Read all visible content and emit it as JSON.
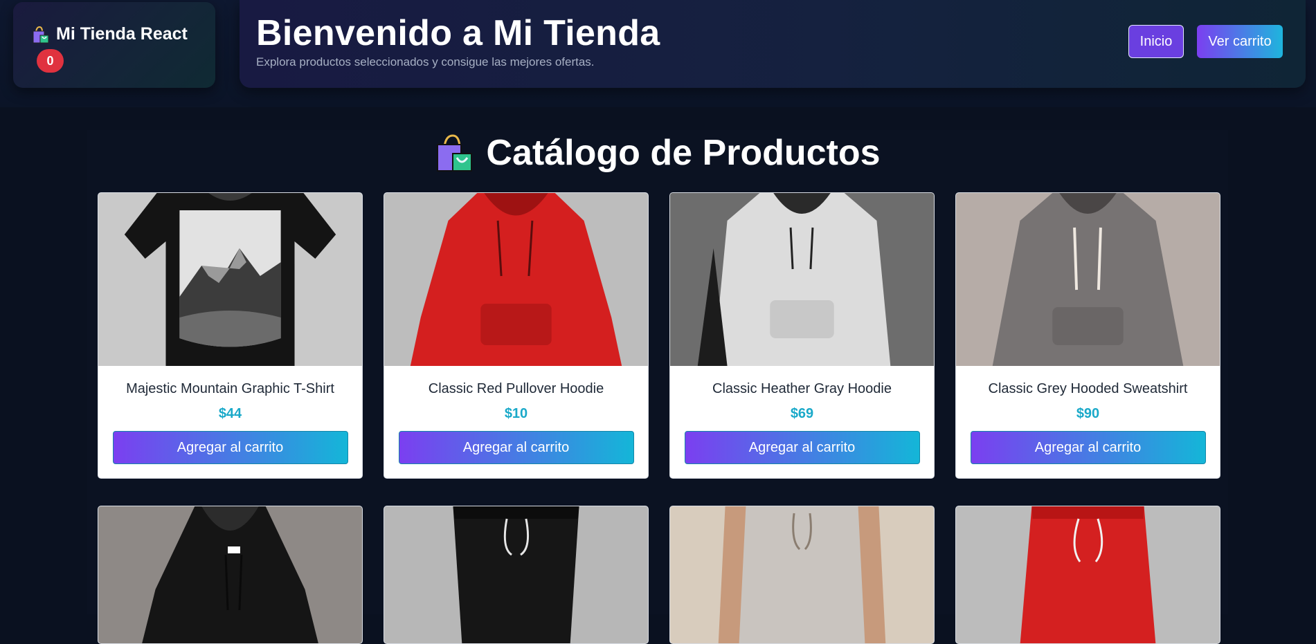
{
  "brand": {
    "title": "Mi Tienda React",
    "cart_count": "0",
    "icon": "shopping-bags-icon"
  },
  "hero": {
    "title": "Bienvenido a Mi Tienda",
    "subtitle": "Explora productos seleccionados y consigue las mejores ofertas."
  },
  "nav": {
    "home_label": "Inicio",
    "cart_label": "Ver carrito"
  },
  "catalog": {
    "title": "Catálogo de Productos",
    "icon": "shopping-bags-icon",
    "add_label": "Agregar al carrito",
    "products": [
      {
        "name": "Majestic Mountain Graphic T-Shirt",
        "price": "$44",
        "image": "black-tshirt-mountain-graphic"
      },
      {
        "name": "Classic Red Pullover Hoodie",
        "price": "$10",
        "image": "red-hoodie"
      },
      {
        "name": "Classic Heather Gray Hoodie",
        "price": "$69",
        "image": "light-gray-hoodie"
      },
      {
        "name": "Classic Grey Hooded Sweatshirt",
        "price": "$90",
        "image": "gray-hoodie"
      }
    ],
    "products_row2": [
      {
        "image": "black-hoodie"
      },
      {
        "image": "black-joggers"
      },
      {
        "image": "beige-joggers"
      },
      {
        "image": "red-joggers"
      }
    ]
  },
  "colors": {
    "background": "#0a1120",
    "accent_purple": "#7b3ff0",
    "accent_cyan": "#14b6d8",
    "badge_red": "#e0323f",
    "price_cyan": "#1aa9c9"
  }
}
